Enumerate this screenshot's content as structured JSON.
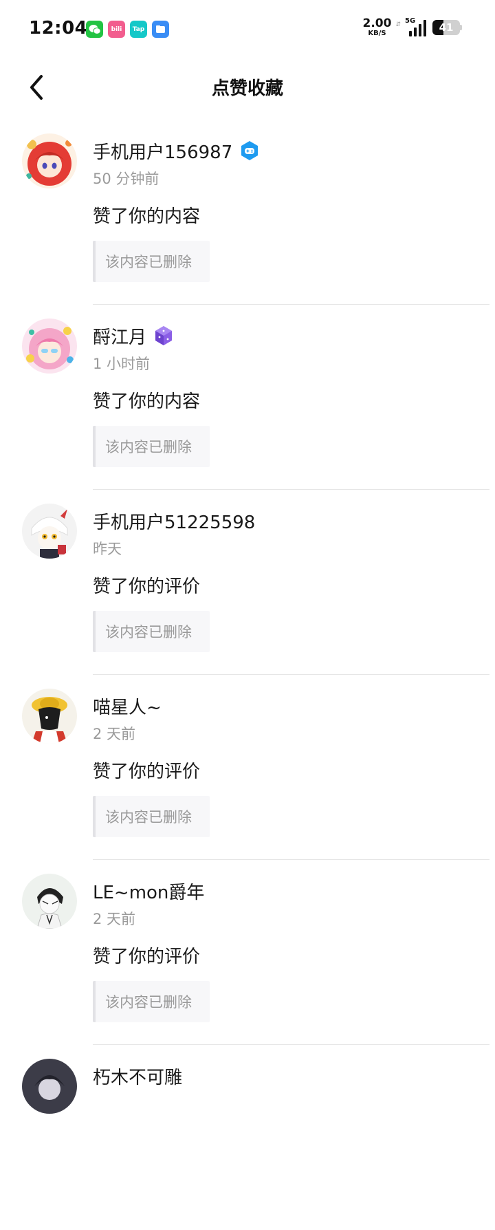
{
  "status_bar": {
    "time": "12:04",
    "net_speed_value": "2.00",
    "net_speed_unit": "KB/S",
    "network_type": "5G",
    "battery_level": "41",
    "apps": [
      {
        "icon": "wechat-icon",
        "label": "",
        "color": "#23c343"
      },
      {
        "icon": "bilibili-icon",
        "label": "bili",
        "color": "#f25d8e"
      },
      {
        "icon": "taptap-icon",
        "label": "Tap",
        "color": "#14c8c8"
      },
      {
        "icon": "files-icon",
        "label": "",
        "color": "#3a8df5"
      }
    ]
  },
  "header": {
    "title": "点赞收藏"
  },
  "feed": [
    {
      "name": "手机用户156987",
      "badge": "gamepad-badge-icon",
      "time": "50 分钟前",
      "action": "赞了你的内容",
      "quote": "该内容已删除"
    },
    {
      "name": "酹江月",
      "badge": "dice-badge-icon",
      "time": "1 小时前",
      "action": "赞了你的内容",
      "quote": "该内容已删除"
    },
    {
      "name": "手机用户51225598",
      "badge": "",
      "time": "昨天",
      "action": "赞了你的评价",
      "quote": "该内容已删除"
    },
    {
      "name": "喵星人~",
      "badge": "",
      "time": "2 天前",
      "action": "赞了你的评价",
      "quote": "该内容已删除"
    },
    {
      "name": "LE~mon爵年",
      "badge": "",
      "time": "2 天前",
      "action": "赞了你的评价",
      "quote": "该内容已删除"
    },
    {
      "name": "朽木不可雕",
      "badge": "",
      "time": "",
      "action": "",
      "quote": ""
    }
  ]
}
